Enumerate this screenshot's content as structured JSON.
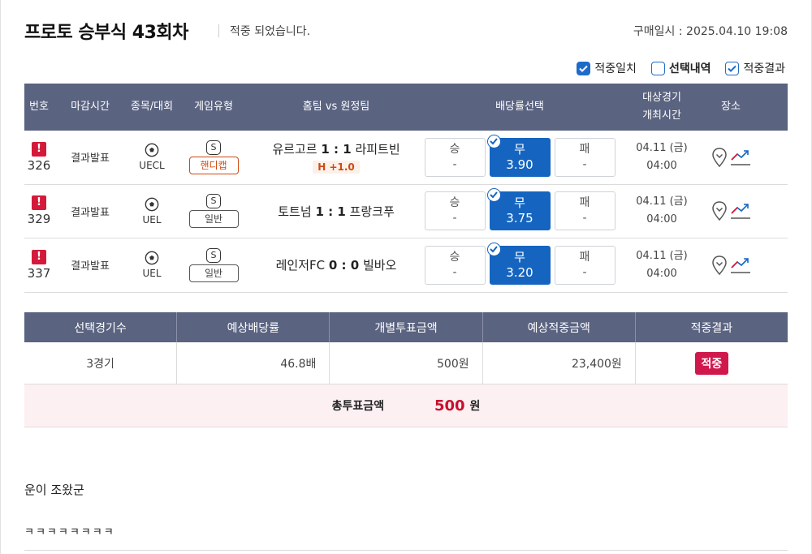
{
  "header": {
    "title": "프로토 승부식 43회차",
    "subtitle": "적중 되었습니다.",
    "purchase_date": "구매일시 : 2025.04.10 19:08"
  },
  "filters": [
    {
      "label": "적중일치",
      "state": "checked"
    },
    {
      "label": "선택내역",
      "state": "unchecked"
    },
    {
      "label": "적중결과",
      "state": "outline"
    }
  ],
  "games_table": {
    "headers": {
      "no": "번호",
      "close": "마감시간",
      "sport": "종목/대회",
      "type": "게임유형",
      "match": "홈팀 vs 원정팀",
      "odds": "배당률선택",
      "time_line1": "대상경기",
      "time_line2": "개최시간",
      "venue": "장소"
    },
    "rows": [
      {
        "no": "326",
        "close": "결과발표",
        "league": "UECL",
        "s_badge": "S",
        "game_type": "핸디캡",
        "game_type_style": "handi",
        "home": "유르고르",
        "score": "1 : 1",
        "away": "라피트빈",
        "handicap": "H +1.0",
        "odds": [
          {
            "label": "승",
            "value": "-",
            "selected": false
          },
          {
            "label": "무",
            "value": "3.90",
            "selected": true
          },
          {
            "label": "패",
            "value": "-",
            "selected": false
          }
        ],
        "date": "04.11 (금)",
        "time": "04:00"
      },
      {
        "no": "329",
        "close": "결과발표",
        "league": "UEL",
        "s_badge": "S",
        "game_type": "일반",
        "game_type_style": "normal",
        "home": "토트넘",
        "score": "1 : 1",
        "away": "프랑크푸",
        "handicap": "",
        "odds": [
          {
            "label": "승",
            "value": "-",
            "selected": false
          },
          {
            "label": "무",
            "value": "3.75",
            "selected": true
          },
          {
            "label": "패",
            "value": "-",
            "selected": false
          }
        ],
        "date": "04.11 (금)",
        "time": "04:00"
      },
      {
        "no": "337",
        "close": "결과발표",
        "league": "UEL",
        "s_badge": "S",
        "game_type": "일반",
        "game_type_style": "normal",
        "home": "레인저FC",
        "score": "0 : 0",
        "away": "빌바오",
        "handicap": "",
        "odds": [
          {
            "label": "승",
            "value": "-",
            "selected": false
          },
          {
            "label": "무",
            "value": "3.20",
            "selected": true
          },
          {
            "label": "패",
            "value": "-",
            "selected": false
          }
        ],
        "date": "04.11 (금)",
        "time": "04:00"
      }
    ]
  },
  "summary": {
    "headers": [
      "선택경기수",
      "예상배당률",
      "개별투표금액",
      "예상적중금액",
      "적중결과"
    ],
    "values": {
      "games": "3경기",
      "odds": "46.8배",
      "bet_amount": "500원",
      "expected_win": "23,400원",
      "result": "적중"
    }
  },
  "total": {
    "label": "총투표금액",
    "amount": "500",
    "unit": "원"
  },
  "comments": {
    "line1": "운이 조왔군",
    "line2": "ㅋㅋㅋㅋㅋㅋㅋㅋ"
  },
  "colors": {
    "header_bg": "#5a6380",
    "selected_odds": "#1565c0",
    "alert": "#d41a3a",
    "win_badge": "#d0184c",
    "total_bg": "#fcf0f2"
  }
}
